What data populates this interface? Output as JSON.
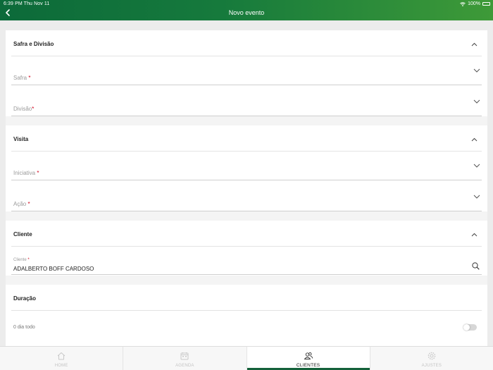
{
  "status_bar": {
    "time_date": "6:39 PM   Thu Nov 11",
    "battery": "100%"
  },
  "nav": {
    "title": "Novo evento",
    "back_icon": "chevron-left-icon"
  },
  "sections": {
    "safra": {
      "title": "Safra e Divisão",
      "fields": {
        "safra": {
          "label": "Safra",
          "required_mark": "*"
        },
        "divisao": {
          "label": "Divisão",
          "required_mark": "*"
        }
      }
    },
    "visita": {
      "title": "Visita",
      "fields": {
        "iniciativa": {
          "label": "Iniciativa",
          "required_mark": "*"
        },
        "acao": {
          "label": "Ação",
          "required_mark": "*"
        }
      }
    },
    "cliente": {
      "title": "Cliente",
      "field": {
        "label": "Cliente",
        "required_mark": "*",
        "value": "ADALBERTO BOFF CARDOSO"
      }
    },
    "duracao": {
      "title": "Duração",
      "all_day_label": "0 dia todo",
      "all_day_on": false
    }
  },
  "tabs": [
    {
      "label": "HOME",
      "icon": "home-icon",
      "active": false
    },
    {
      "label": "AGENDA",
      "icon": "calendar-icon",
      "active": false
    },
    {
      "label": "CLIENTES",
      "icon": "users-icon",
      "active": true
    },
    {
      "label": "AJUSTES",
      "icon": "gear-icon",
      "active": false
    }
  ],
  "colors": {
    "header_start": "#0c6a3a",
    "header_end": "#3e9a38",
    "required": "#d0021b",
    "active_tab_indicator": "#14613a"
  }
}
